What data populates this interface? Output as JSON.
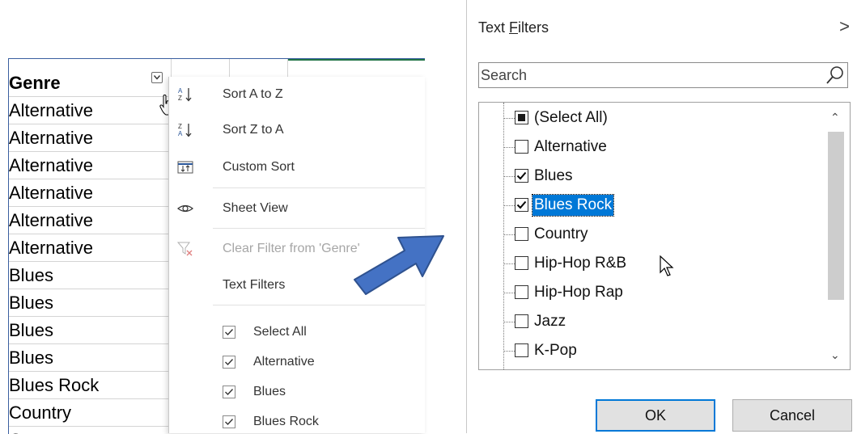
{
  "sheet": {
    "header": "Genre",
    "cells": [
      "Alternative",
      "Alternative",
      "Alternative",
      "Alternative",
      "Alternative",
      "Alternative",
      "Blues",
      "Blues",
      "Blues",
      "Blues",
      "Blues Rock",
      "Country",
      "Country"
    ]
  },
  "menu": {
    "sort_az": "Sort A to Z",
    "sort_za": "Sort Z to A",
    "custom_sort": "Custom Sort",
    "sheet_view": "Sheet View",
    "clear_filter": "Clear Filter from 'Genre'",
    "text_filters": "Text Filters",
    "check_items": [
      {
        "label": "Select All",
        "checked": true
      },
      {
        "label": "Alternative",
        "checked": true
      },
      {
        "label": "Blues",
        "checked": true
      },
      {
        "label": "Blues Rock",
        "checked": true
      }
    ]
  },
  "dialog": {
    "title": "Text Filters",
    "title_underline": "F",
    "chevron": ">",
    "search_placeholder": "Search",
    "items": [
      {
        "label": "(Select All)",
        "state": "partial"
      },
      {
        "label": "Alternative",
        "state": "unchecked"
      },
      {
        "label": "Blues",
        "state": "checked"
      },
      {
        "label": "Blues Rock",
        "state": "checked",
        "selected": true
      },
      {
        "label": "Country",
        "state": "unchecked"
      },
      {
        "label": "Hip-Hop R&B",
        "state": "unchecked"
      },
      {
        "label": "Hip-Hop Rap",
        "state": "unchecked"
      },
      {
        "label": "Jazz",
        "state": "unchecked"
      },
      {
        "label": "K-Pop",
        "state": "unchecked"
      }
    ],
    "ok_label": "OK",
    "cancel_label": "Cancel"
  },
  "colors": {
    "accent": "#0078d7",
    "arrow": "#4472c4",
    "excel_green": "#217346"
  }
}
